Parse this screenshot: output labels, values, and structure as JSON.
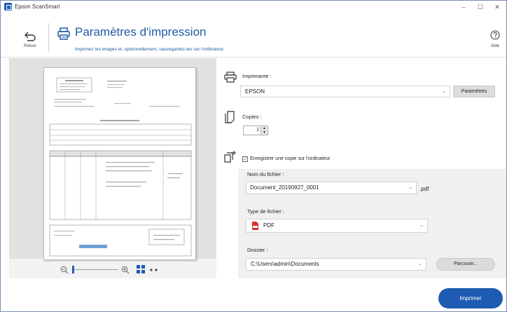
{
  "window": {
    "title": "Epson ScanSmart",
    "minimize": "–",
    "maximize": "☐",
    "close": "✕"
  },
  "header": {
    "back_label": "Retour",
    "title": "Paramètres d'impression",
    "subtitle": "Imprimez les images et, optionnellement, sauvegardez-les sur l'ordinateur.",
    "help_label": "Aide"
  },
  "printer": {
    "label": "Imprimante :",
    "value": "EPSON",
    "settings_button": "Paramètres"
  },
  "copies": {
    "label": "Copies :",
    "value": "1"
  },
  "save_copy": {
    "checkbox_label": "Enregistrer une copie sur l'ordinateur",
    "checked": true,
    "filename_label": "Nom du fichier :",
    "filename_value": "Document_20190927_0001",
    "extension": ".pdf",
    "filetype_label": "Type de fichier :",
    "filetype_value": "PDF",
    "folder_label": "Dossier :",
    "folder_value": "C:\\Users\\admin\\Documents",
    "browse_button": "Parcourir..."
  },
  "actions": {
    "print_button": "Imprimer"
  },
  "colors": {
    "accent": "#1e5bb3",
    "title_blue": "#1f5ba5",
    "pdf_red": "#d9342b"
  }
}
